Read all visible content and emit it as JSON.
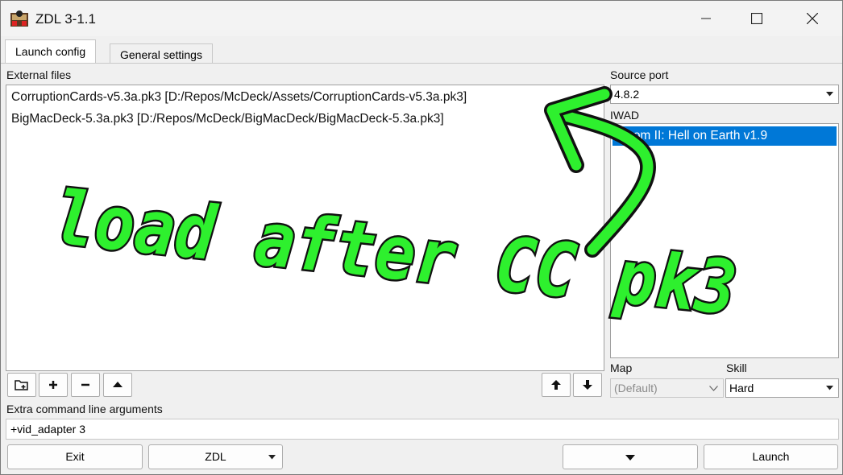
{
  "window": {
    "title": "ZDL 3-1.1"
  },
  "tabs": [
    {
      "label": "Launch config",
      "active": true
    },
    {
      "label": "General settings",
      "active": false
    }
  ],
  "external_files": {
    "label": "External files",
    "items": [
      "CorruptionCards-v5.3a.pk3 [D:/Repos/McDeck/Assets/CorruptionCards-v5.3a.pk3]",
      "BigMacDeck-5.3a.pk3 [D:/Repos/McDeck/BigMacDeck/BigMacDeck-5.3a.pk3]"
    ]
  },
  "source_port": {
    "label": "Source port",
    "value": "4.8.2"
  },
  "iwad": {
    "label": "IWAD",
    "items": [
      "Doom II: Hell on Earth v1.9"
    ],
    "selected": 0
  },
  "map": {
    "label": "Map",
    "value": "(Default)"
  },
  "skill": {
    "label": "Skill",
    "value": "Hard"
  },
  "extra_args": {
    "label": "Extra command line arguments",
    "value": "+vid_adapter 3"
  },
  "buttons": {
    "exit": "Exit",
    "zdl": "ZDL",
    "launch": "Launch"
  },
  "annotation": {
    "text": "load after CC pk3",
    "color": "#2ef02e"
  },
  "colors": {
    "selection": "#0078d7",
    "window_bg": "#f0f0f0"
  }
}
